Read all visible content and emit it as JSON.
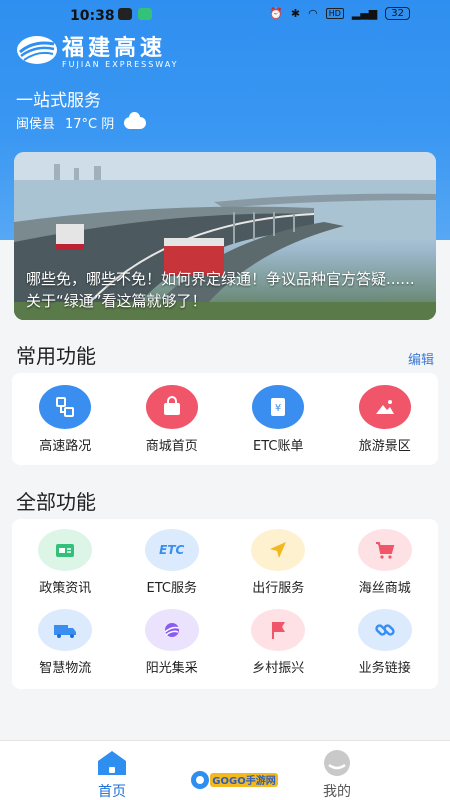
{
  "status": {
    "time": "10:38",
    "battery": "32"
  },
  "brand": {
    "name_cn": "福建高速",
    "name_en": "FUJIAN EXPRESSWAY"
  },
  "header": {
    "service_title": "一站式服务",
    "location": "闽侯县",
    "weather": "17°C 阴"
  },
  "banner": {
    "caption": "哪些免，哪些不免！如何界定绿通！争议品种官方答疑......关于“绿通”看这篇就够了！"
  },
  "common": {
    "title": "常用功能",
    "edit_label": "编辑",
    "items": [
      {
        "label": "高速路况",
        "icon": "road-condition-icon",
        "color": "#3a8ef0"
      },
      {
        "label": "商城首页",
        "icon": "shop-bag-icon",
        "color": "#f0556a"
      },
      {
        "label": "ETC账单",
        "icon": "bill-icon",
        "color": "#3a8ef0"
      },
      {
        "label": "旅游景区",
        "icon": "scenery-icon",
        "color": "#f0556a"
      }
    ]
  },
  "all": {
    "title": "全部功能",
    "rows": [
      [
        {
          "label": "政策资讯",
          "icon": "news-card-icon",
          "color": "#32c07a"
        },
        {
          "label": "ETC服务",
          "icon": "etc-icon",
          "color": "#3a8ef0",
          "text": "ETC"
        },
        {
          "label": "出行服务",
          "icon": "navigation-arrow-icon",
          "color": "#f2b81e"
        },
        {
          "label": "海丝商城",
          "icon": "cart-icon",
          "color": "#f0556a"
        }
      ],
      [
        {
          "label": "智慧物流",
          "icon": "truck-icon",
          "color": "#3a8ef0"
        },
        {
          "label": "阳光集采",
          "icon": "planet-icon",
          "color": "#8b5cf0"
        },
        {
          "label": "乡村振兴",
          "icon": "flag-icon",
          "color": "#f0556a"
        },
        {
          "label": "业务链接",
          "icon": "link-icon",
          "color": "#3a8ef0"
        }
      ]
    ]
  },
  "tabs": [
    {
      "label": "首页",
      "icon": "home-icon",
      "active": true
    },
    {
      "label": "我的",
      "icon": "profile-icon",
      "active": false
    }
  ],
  "watermark": {
    "text": "GOGO手游网"
  },
  "colors": {
    "primary": "#2f8ff0",
    "active_tab": "#1e6fd9",
    "inactive_tab": "#555555"
  }
}
